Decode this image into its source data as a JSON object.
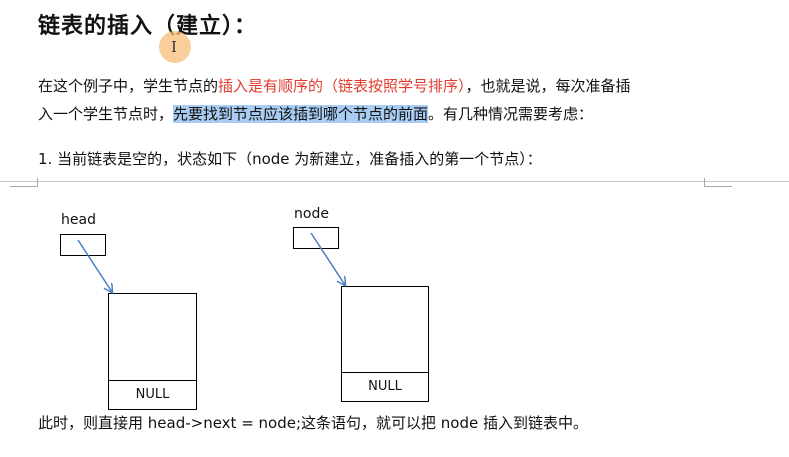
{
  "document": {
    "title": "链表的插入（建立）：",
    "cursor_glyph": "I",
    "paragraph": {
      "line1_before": "在这个例子中，学生节点的",
      "line1_red": "插入是有顺序的（链表按照学号排序）",
      "line1_after": "，也就是说，每次准备插",
      "line2_before": "入一个学生节点时，",
      "line2_highlight": "先要找到节点应该插到哪个节点的前面",
      "line2_after": "。有几种情况需要考虑："
    },
    "list_item_1": "1.  当前链表是空的，状态如下（node 为新建立，准备插入的第一个节点）：",
    "diagram": {
      "head_label": "head",
      "node_label": "node",
      "head_null": "NULL",
      "node_null": "NULL"
    },
    "bottom_text": "此时，则直接用 head->next = node;这条语句，就可以把 node 插入到链表中。"
  },
  "colors": {
    "emphasis_red": "#e23b2e",
    "selection_highlight": "#a9cdf2",
    "arrow_blue": "#4a7fc1"
  }
}
